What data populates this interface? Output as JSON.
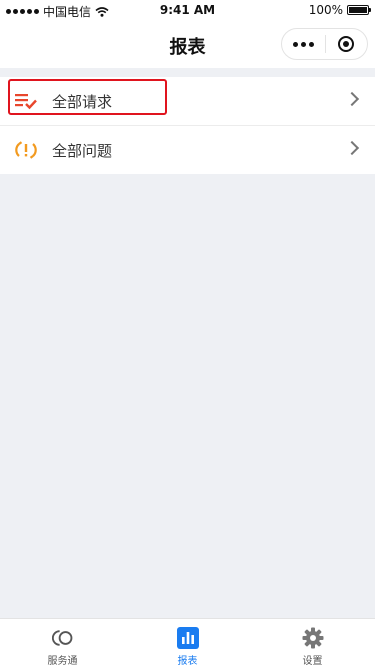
{
  "status_bar": {
    "carrier": "中国电信",
    "time": "9:41 AM",
    "battery": "100%"
  },
  "nav": {
    "title": "报表",
    "more_icon": "more-dots-icon",
    "close_icon": "close-ring-icon"
  },
  "list": {
    "items": [
      {
        "label": "全部请求",
        "icon": "request-list-icon",
        "icon_color": "#e8462c",
        "highlighted": true
      },
      {
        "label": "全部问题",
        "icon": "problem-icon",
        "icon_color": "#f29a1f",
        "highlighted": false
      }
    ]
  },
  "tab_bar": {
    "active_color": "#1a7cf0",
    "tabs": [
      {
        "label": "服务通",
        "icon": "service-icon",
        "active": false
      },
      {
        "label": "报表",
        "icon": "bar-chart-icon",
        "active": true
      },
      {
        "label": "设置",
        "icon": "gear-icon",
        "active": false
      }
    ]
  }
}
